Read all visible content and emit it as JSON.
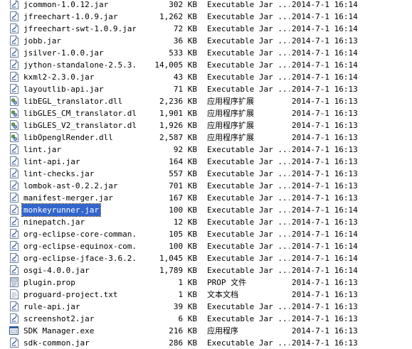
{
  "files": [
    {
      "name": "jcommon-1.0.12.jar",
      "size": "302 KB",
      "type": "Executable Jar ...",
      "modified": "2014-7-1 16:14",
      "icon": "jar-file-icon"
    },
    {
      "name": "jfreechart-1.0.9.jar",
      "size": "1,262 KB",
      "type": "Executable Jar ...",
      "modified": "2014-7-1 16:14",
      "icon": "jar-file-icon"
    },
    {
      "name": "jfreechart-swt-1.0.9.jar",
      "size": "72 KB",
      "type": "Executable Jar ...",
      "modified": "2014-7-1 16:14",
      "icon": "jar-file-icon"
    },
    {
      "name": "jobb.jar",
      "size": "36 KB",
      "type": "Executable Jar ...",
      "modified": "2014-7-1 16:13",
      "icon": "jar-file-icon"
    },
    {
      "name": "jsilver-1.0.0.jar",
      "size": "533 KB",
      "type": "Executable Jar ...",
      "modified": "2014-7-1 16:14",
      "icon": "jar-file-icon"
    },
    {
      "name": "jython-standalone-2.5.3...",
      "size": "14,005 KB",
      "type": "Executable Jar ...",
      "modified": "2014-7-1 16:14",
      "icon": "jar-file-icon"
    },
    {
      "name": "kxml2-2.3.0.jar",
      "size": "43 KB",
      "type": "Executable Jar ...",
      "modified": "2014-7-1 16:14",
      "icon": "jar-file-icon"
    },
    {
      "name": "layoutlib-api.jar",
      "size": "71 KB",
      "type": "Executable Jar ...",
      "modified": "2014-7-1 16:13",
      "icon": "jar-file-icon"
    },
    {
      "name": "libEGL_translator.dll",
      "size": "2,236 KB",
      "type": "应用程序扩展",
      "modified": "2014-7-1 16:13",
      "icon": "dll-file-icon"
    },
    {
      "name": "libGLES_CM_translator.dll",
      "size": "1,901 KB",
      "type": "应用程序扩展",
      "modified": "2014-7-1 16:13",
      "icon": "dll-file-icon"
    },
    {
      "name": "libGLES_V2_translator.dll",
      "size": "1,926 KB",
      "type": "应用程序扩展",
      "modified": "2014-7-1 16:13",
      "icon": "dll-file-icon"
    },
    {
      "name": "libOpenglRender.dll",
      "size": "2,587 KB",
      "type": "应用程序扩展",
      "modified": "2014-7-1 16:13",
      "icon": "dll-file-icon"
    },
    {
      "name": "lint.jar",
      "size": "92 KB",
      "type": "Executable Jar ...",
      "modified": "2014-7-1 16:13",
      "icon": "jar-file-icon"
    },
    {
      "name": "lint-api.jar",
      "size": "164 KB",
      "type": "Executable Jar ...",
      "modified": "2014-7-1 16:13",
      "icon": "jar-file-icon"
    },
    {
      "name": "lint-checks.jar",
      "size": "557 KB",
      "type": "Executable Jar ...",
      "modified": "2014-7-1 16:13",
      "icon": "jar-file-icon"
    },
    {
      "name": "lombok-ast-0.2.2.jar",
      "size": "701 KB",
      "type": "Executable Jar ...",
      "modified": "2014-7-1 16:13",
      "icon": "jar-file-icon"
    },
    {
      "name": "manifest-merger.jar",
      "size": "167 KB",
      "type": "Executable Jar ...",
      "modified": "2014-7-1 16:13",
      "icon": "jar-file-icon"
    },
    {
      "name": "monkeyrunner.jar",
      "size": "100 KB",
      "type": "Executable Jar ...",
      "modified": "2014-7-1 16:14",
      "icon": "jar-file-icon",
      "selected": true
    },
    {
      "name": "ninepatch.jar",
      "size": "12 KB",
      "type": "Executable Jar ...",
      "modified": "2014-7-1 16:13",
      "icon": "jar-file-icon"
    },
    {
      "name": "org-eclipse-core-comman...",
      "size": "105 KB",
      "type": "Executable Jar ...",
      "modified": "2014-7-1 16:14",
      "icon": "jar-file-icon"
    },
    {
      "name": "org-eclipse-equinox-com...",
      "size": "100 KB",
      "type": "Executable Jar ...",
      "modified": "2014-7-1 16:14",
      "icon": "jar-file-icon"
    },
    {
      "name": "org-eclipse-jface-3.6.2...",
      "size": "1,045 KB",
      "type": "Executable Jar ...",
      "modified": "2014-7-1 16:14",
      "icon": "jar-file-icon"
    },
    {
      "name": "osgi-4.0.0.jar",
      "size": "1,789 KB",
      "type": "Executable Jar ...",
      "modified": "2014-7-1 16:14",
      "icon": "jar-file-icon"
    },
    {
      "name": "plugin.prop",
      "size": "1 KB",
      "type": "PROP 文件",
      "modified": "2014-7-1 16:13",
      "icon": "prop-file-icon"
    },
    {
      "name": "proguard-project.txt",
      "size": "1 KB",
      "type": "文本文档",
      "modified": "2014-7-1 16:13",
      "icon": "text-file-icon"
    },
    {
      "name": "rule-api.jar",
      "size": "39 KB",
      "type": "Executable Jar ...",
      "modified": "2014-7-1 16:13",
      "icon": "jar-file-icon"
    },
    {
      "name": "screenshot2.jar",
      "size": "6 KB",
      "type": "Executable Jar ...",
      "modified": "2014-7-1 16:13",
      "icon": "jar-file-icon"
    },
    {
      "name": "SDK Manager.exe",
      "size": "216 KB",
      "type": "应用程序",
      "modified": "2014-7-1 16:13",
      "icon": "exe-file-icon"
    },
    {
      "name": "sdk-common.jar",
      "size": "286 KB",
      "type": "Executable Jar ...",
      "modified": "2014-7-1 16:13",
      "icon": "jar-file-icon"
    }
  ]
}
